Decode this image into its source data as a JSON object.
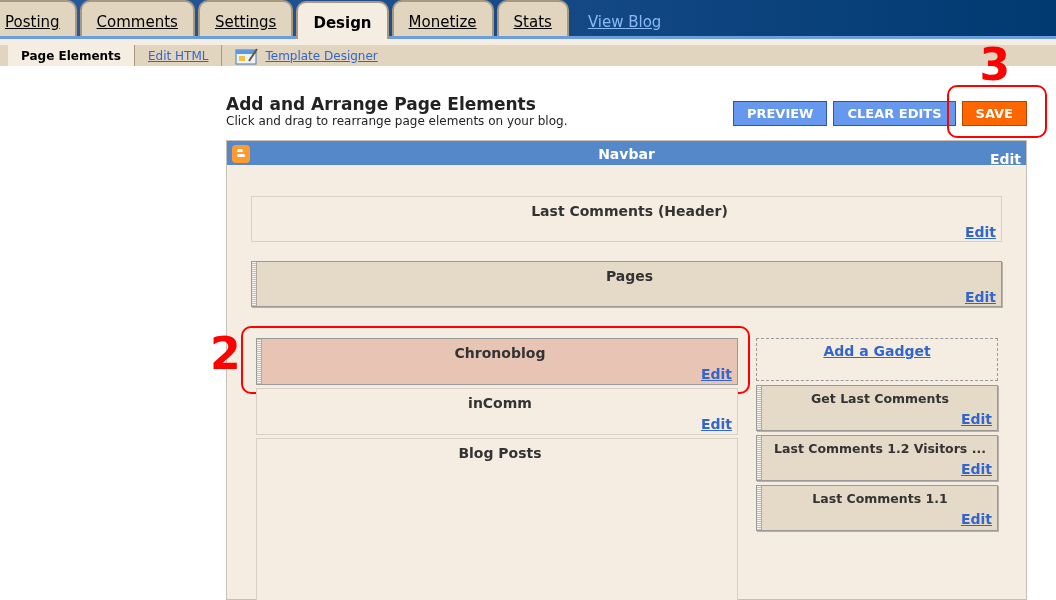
{
  "tabs": [
    {
      "label": "Posting",
      "selected": false
    },
    {
      "label": "Comments",
      "selected": false
    },
    {
      "label": "Settings",
      "selected": false
    },
    {
      "label": "Design",
      "selected": true
    },
    {
      "label": "Monetize",
      "selected": false
    },
    {
      "label": "Stats",
      "selected": false
    }
  ],
  "view_blog": "View Blog",
  "subtabs": [
    {
      "label": "Page Elements",
      "selected": true,
      "kind": "text"
    },
    {
      "label": "Edit HTML",
      "selected": false,
      "kind": "text"
    },
    {
      "label": "Template Designer",
      "selected": false,
      "kind": "icon"
    }
  ],
  "heading": {
    "title": "Add and Arrange Page Elements",
    "subtitle": "Click and drag to rearrange page elements on your blog."
  },
  "buttons": [
    {
      "label": "PREVIEW",
      "kind": "primary"
    },
    {
      "label": "CLEAR EDITS",
      "kind": "primary"
    },
    {
      "label": "SAVE",
      "kind": "save",
      "annotation": "3"
    }
  ],
  "navbar": {
    "title": "Navbar",
    "edit": "Edit"
  },
  "full_width": [
    {
      "title": "Last Comments (Header)",
      "edit": "Edit",
      "kind": "plain"
    },
    {
      "title": "Pages",
      "edit": "Edit",
      "kind": "movable"
    }
  ],
  "main_column": [
    {
      "title": "Chronoblog",
      "edit": "Edit",
      "kind": "highlighted",
      "annotation": "2"
    },
    {
      "title": "inComm",
      "edit": "Edit",
      "kind": "plain"
    },
    {
      "title": "Blog Posts",
      "kind": "tall"
    }
  ],
  "sidebar": {
    "add_gadget": "Add a Gadget",
    "gadgets": [
      {
        "title": "Get Last Comments",
        "edit": "Edit",
        "kind": "movable"
      },
      {
        "title": "Last Comments 1.2 Visitors ...",
        "edit": "Edit",
        "kind": "movable"
      },
      {
        "title": "Last Comments 1.1",
        "edit": "Edit",
        "kind": "movable"
      }
    ]
  }
}
